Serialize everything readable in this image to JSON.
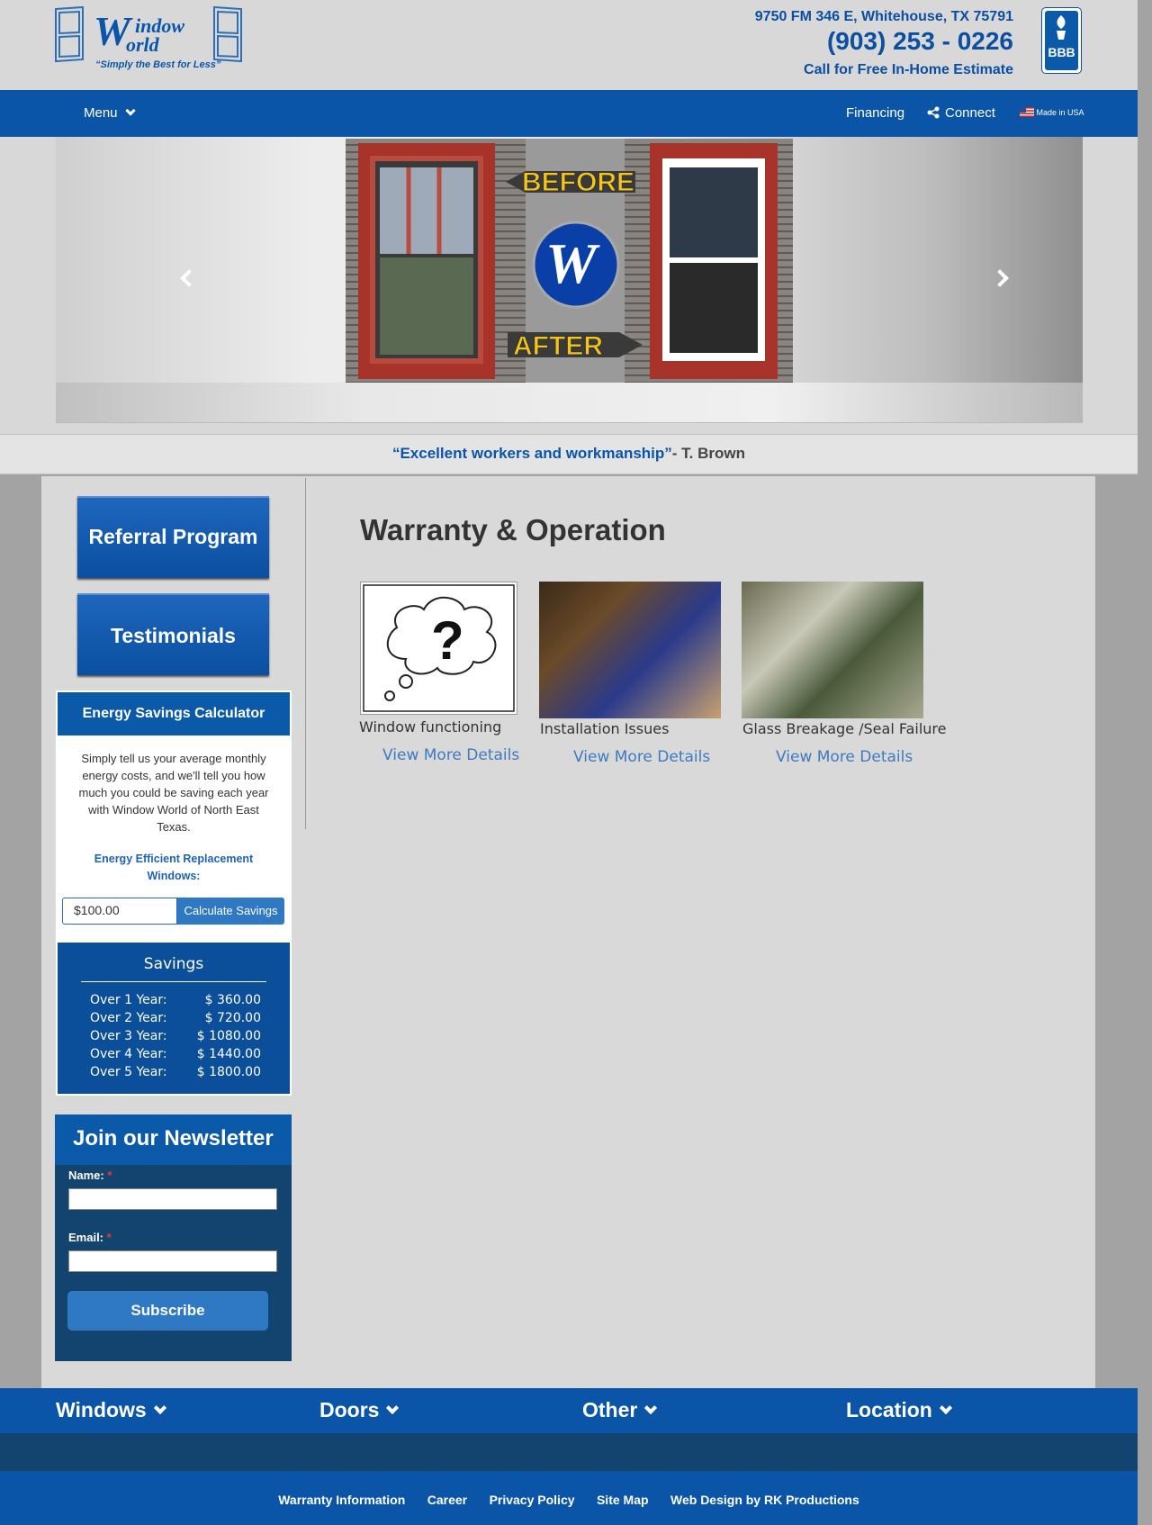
{
  "header": {
    "logo_alt": "Window World",
    "tagline": "“Simply the Best for Less”",
    "address": "9750 FM 346 E, Whitehouse, TX 75791",
    "phone": "(903) 253 - 0226",
    "estimate": "Call for Free In-Home Estimate",
    "bbb": "BBB"
  },
  "nav": {
    "menu": "Menu",
    "financing": "Financing",
    "connect": "Connect",
    "made_in_usa": "Made in USA"
  },
  "hero": {
    "before": "BEFORE",
    "after": "AFTER"
  },
  "quote": {
    "text": "“Excellent workers and workmanship”",
    "author": "- T. Brown"
  },
  "sidebar": {
    "referral": "Referral Program",
    "testimonials": "Testimonials",
    "calculator": {
      "title": "Energy Savings Calculator",
      "description": "Simply tell us your average monthly energy costs, and we'll tell you how much you could be saving each year with Window World of North East Texas.",
      "link": "Energy Efficient Replacement Windows:",
      "input_value": "$100.00",
      "button": "Calculate Savings",
      "savings_title": "Savings",
      "rows": [
        {
          "label": "Over 1 Year:",
          "value": "$ 360.00"
        },
        {
          "label": "Over 2 Year:",
          "value": "$ 720.00"
        },
        {
          "label": "Over 3 Year:",
          "value": "$ 1080.00"
        },
        {
          "label": "Over 4 Year:",
          "value": "$ 1440.00"
        },
        {
          "label": "Over 5 Year:",
          "value": "$ 1800.00"
        }
      ]
    },
    "newsletter": {
      "title": "Join our Newsletter",
      "name_label": "Name:",
      "email_label": "Email:",
      "required": "*",
      "subscribe": "Subscribe"
    }
  },
  "content": {
    "title": "Warranty & Operation",
    "cards": [
      {
        "title": "Window functioning",
        "link": "View More Details"
      },
      {
        "title": "Installation Issues",
        "link": "View More Details"
      },
      {
        "title": "Glass Breakage /Seal Failure",
        "link": "View More Details"
      }
    ]
  },
  "footer_nav": {
    "windows": "Windows",
    "doors": "Doors",
    "other": "Other",
    "location": "Location"
  },
  "footer_links": [
    "Warranty Information",
    "Career",
    "Privacy Policy",
    "Site Map",
    "Web Design by RK Productions"
  ],
  "colors": {
    "brand_blue": "#0b55a8",
    "dark_blue": "#13446f",
    "link_blue": "#3e7bc0"
  }
}
